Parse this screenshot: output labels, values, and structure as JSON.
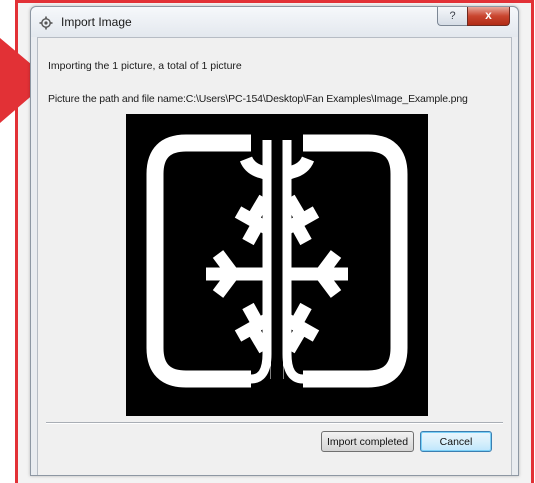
{
  "dialog": {
    "title": "Import Image",
    "help_symbol": "?",
    "close_symbol": "x"
  },
  "info": {
    "line1": "Importing the 1 picture, a total of 1 picture",
    "line2": "Picture the path and file name:C:\\Users\\PC-154\\Desktop\\Fan Examples\\Image_Example.png"
  },
  "buttons": {
    "import_completed": "Import completed",
    "cancel": "Cancel"
  },
  "colors": {
    "annotation_red": "#e23136",
    "preview_background": "#000000",
    "preview_foreground": "#ffffff"
  },
  "icons": {
    "title": "gear-icon",
    "preview": "snowflake-fan-logo"
  }
}
